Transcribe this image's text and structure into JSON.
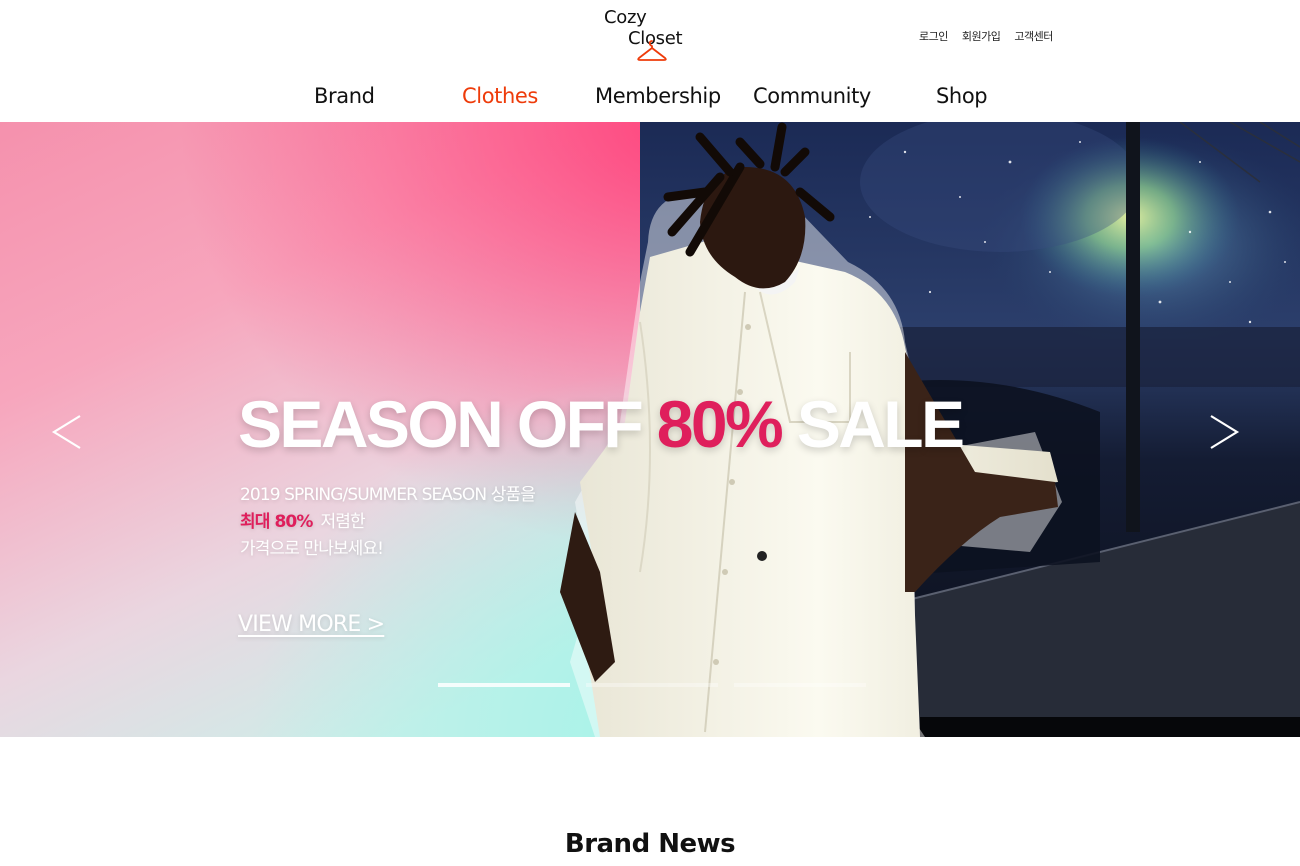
{
  "brand": {
    "logo_line1": "Cozy",
    "logo_line2": "Closet",
    "accent_color": "#ee3b0a"
  },
  "util_links": [
    "로그인",
    "회원가입",
    "고객센터"
  ],
  "nav": {
    "items": [
      "Brand",
      "Clothes",
      "Membership",
      "Community",
      "Shop"
    ],
    "active": "Clothes"
  },
  "hero": {
    "title_pre": "SEASON OFF ",
    "title_highlight": "80%",
    "title_post": " SALE",
    "subtitle_line1": "2019 SPRING/SUMMER SEASON 상품을",
    "subtitle_line2_highlight": "최대 80%",
    "subtitle_line2_rest": "저렴한",
    "subtitle_line3": "가격으로 만나보세요!",
    "cta": "VIEW MORE >",
    "prev_icon": "chevron-left-icon",
    "next_icon": "chevron-right-icon",
    "slide_count": 3,
    "active_slide": 1,
    "highlight_color": "#df1f5c"
  },
  "section": {
    "title": "Brand News"
  }
}
